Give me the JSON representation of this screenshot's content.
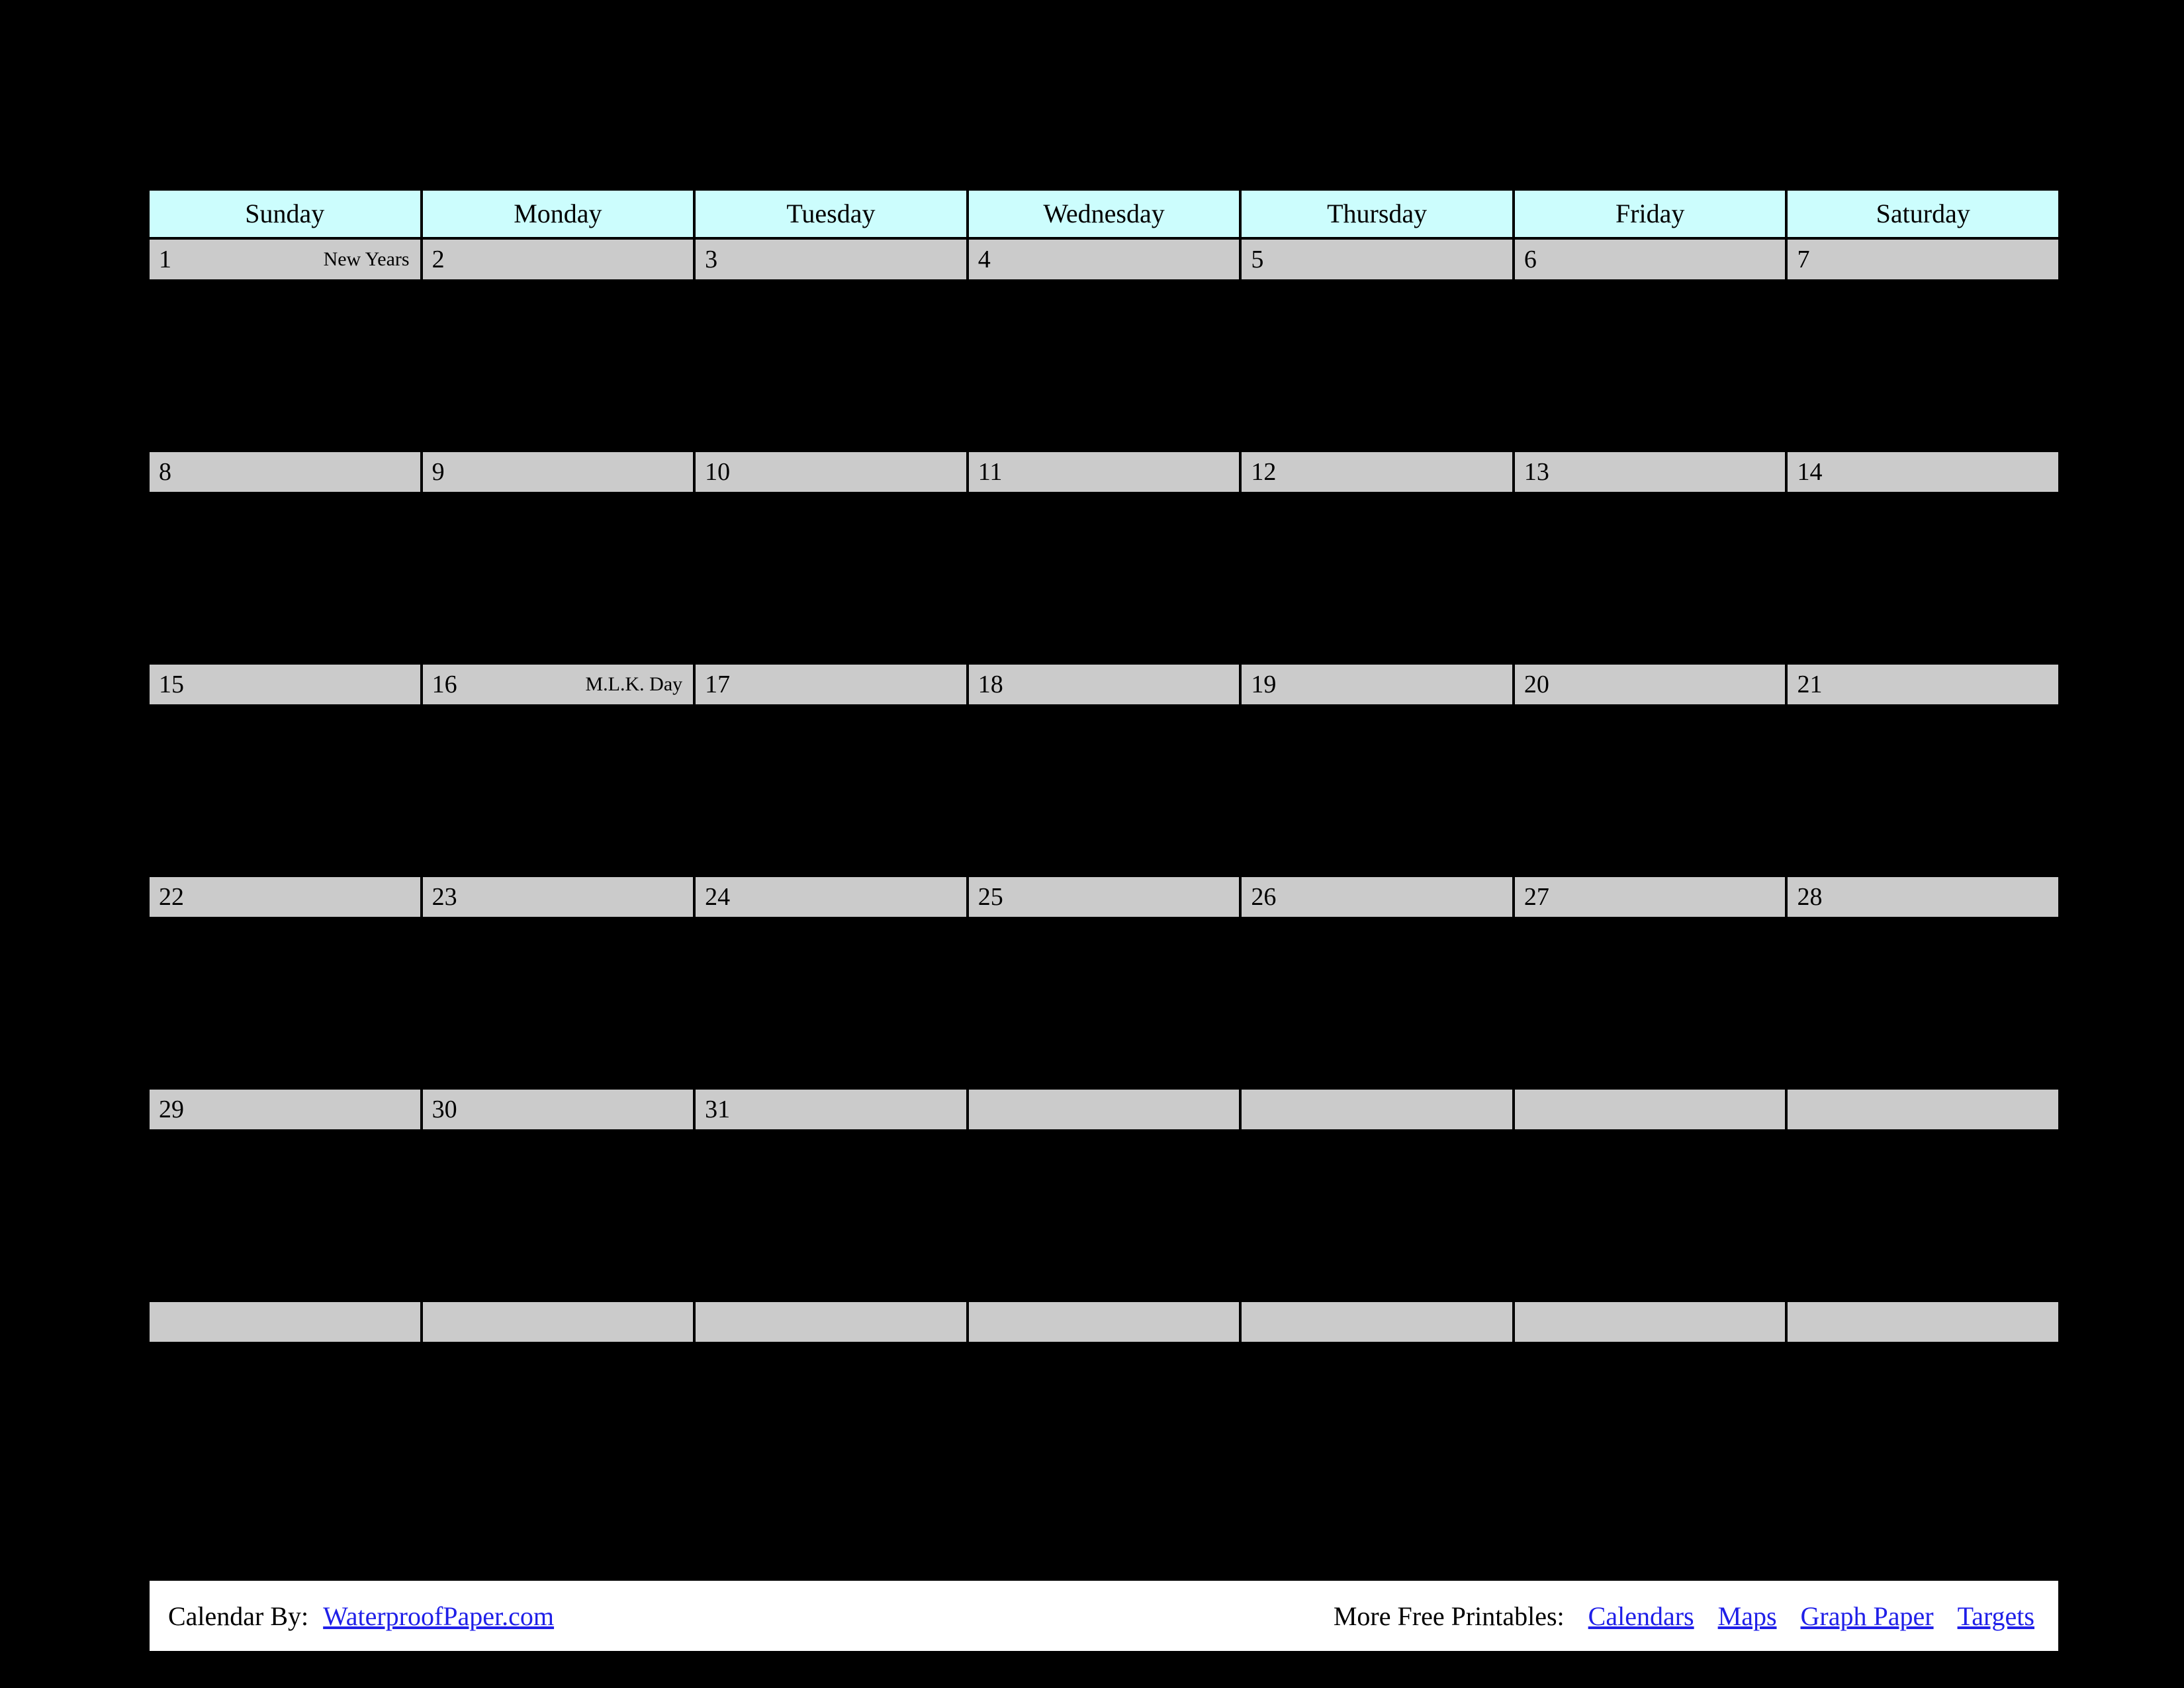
{
  "colors": {
    "page_background": "#000000",
    "header_cell": "#ccfdfd",
    "day_cell": "#cbcbcb",
    "grid_line": "#000000",
    "footer_background": "#ffffff",
    "link": "#1f1fe8",
    "text": "#000000"
  },
  "calendar": {
    "day_headers": [
      "Sunday",
      "Monday",
      "Tuesday",
      "Wednesday",
      "Thursday",
      "Friday",
      "Saturday"
    ],
    "weeks": [
      [
        {
          "day": "1",
          "event": "New Years"
        },
        {
          "day": "2",
          "event": ""
        },
        {
          "day": "3",
          "event": ""
        },
        {
          "day": "4",
          "event": ""
        },
        {
          "day": "5",
          "event": ""
        },
        {
          "day": "6",
          "event": ""
        },
        {
          "day": "7",
          "event": ""
        }
      ],
      [
        {
          "day": "8",
          "event": ""
        },
        {
          "day": "9",
          "event": ""
        },
        {
          "day": "10",
          "event": ""
        },
        {
          "day": "11",
          "event": ""
        },
        {
          "day": "12",
          "event": ""
        },
        {
          "day": "13",
          "event": ""
        },
        {
          "day": "14",
          "event": ""
        }
      ],
      [
        {
          "day": "15",
          "event": ""
        },
        {
          "day": "16",
          "event": "M.L.K. Day"
        },
        {
          "day": "17",
          "event": ""
        },
        {
          "day": "18",
          "event": ""
        },
        {
          "day": "19",
          "event": ""
        },
        {
          "day": "20",
          "event": ""
        },
        {
          "day": "21",
          "event": ""
        }
      ],
      [
        {
          "day": "22",
          "event": ""
        },
        {
          "day": "23",
          "event": ""
        },
        {
          "day": "24",
          "event": ""
        },
        {
          "day": "25",
          "event": ""
        },
        {
          "day": "26",
          "event": ""
        },
        {
          "day": "27",
          "event": ""
        },
        {
          "day": "28",
          "event": ""
        }
      ],
      [
        {
          "day": "29",
          "event": ""
        },
        {
          "day": "30",
          "event": ""
        },
        {
          "day": "31",
          "event": ""
        },
        {
          "day": "",
          "event": ""
        },
        {
          "day": "",
          "event": ""
        },
        {
          "day": "",
          "event": ""
        },
        {
          "day": "",
          "event": ""
        }
      ],
      [
        {
          "day": "",
          "event": ""
        },
        {
          "day": "",
          "event": ""
        },
        {
          "day": "",
          "event": ""
        },
        {
          "day": "",
          "event": ""
        },
        {
          "day": "",
          "event": ""
        },
        {
          "day": "",
          "event": ""
        },
        {
          "day": "",
          "event": ""
        }
      ]
    ]
  },
  "footer": {
    "credit_label": "Calendar By:",
    "credit_link": "WaterproofPaper.com",
    "printables_label": "More Free Printables:",
    "printables_links": [
      "Calendars",
      "Maps",
      "Graph Paper",
      "Targets"
    ]
  }
}
